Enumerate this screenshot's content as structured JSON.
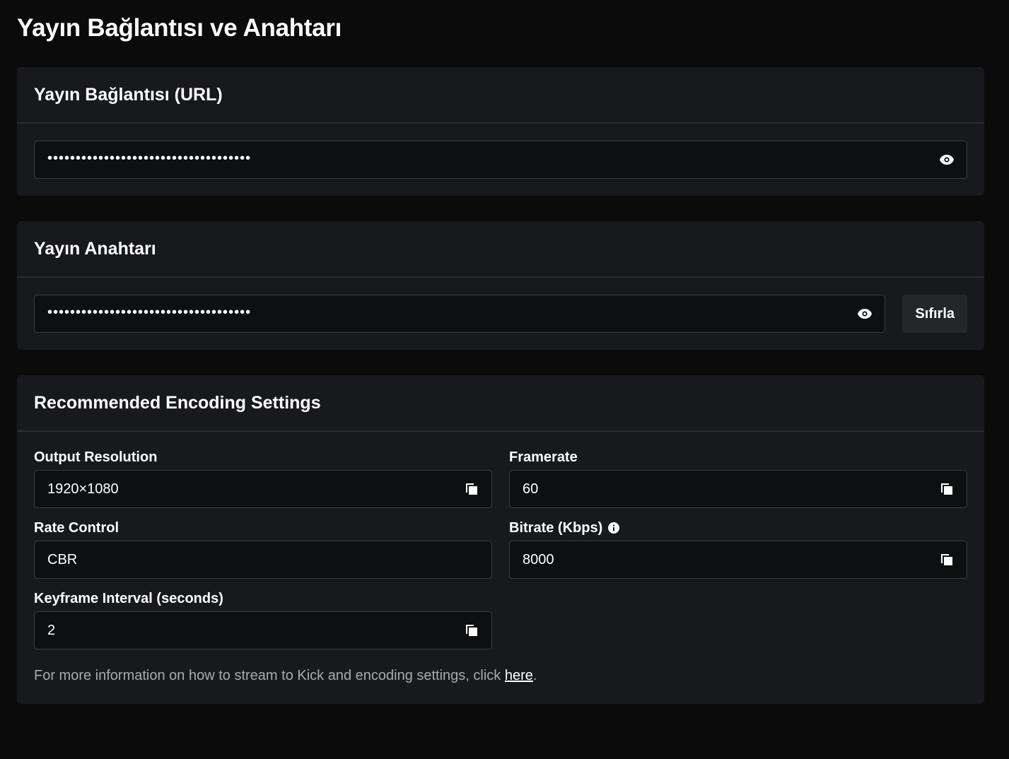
{
  "page": {
    "title": "Yayın Bağlantısı ve Anahtarı"
  },
  "stream_url": {
    "title": "Yayın Bağlantısı (URL)",
    "masked_value": "••••••••••••••••••••••••••••••••••••",
    "reveal_icon": "eye-icon"
  },
  "stream_key": {
    "title": "Yayın Anahtarı",
    "masked_value": "••••••••••••••••••••••••••••••••••••",
    "reveal_icon": "eye-icon",
    "reset_label": "Sıfırla"
  },
  "encoding": {
    "title": "Recommended Encoding Settings",
    "fields": {
      "output_resolution": {
        "label": "Output Resolution",
        "value": "1920×1080",
        "icon": "copy-icon"
      },
      "framerate": {
        "label": "Framerate",
        "value": "60",
        "icon": "copy-icon"
      },
      "rate_control": {
        "label": "Rate Control",
        "value": "CBR"
      },
      "bitrate": {
        "label": "Bitrate (Kbps)",
        "value": "8000",
        "icon": "copy-icon",
        "info_icon": "info-icon"
      },
      "keyframe_interval": {
        "label": "Keyframe Interval (seconds)",
        "value": "2",
        "icon": "copy-icon"
      }
    },
    "footer": {
      "text": "For more information on how to stream to Kick and encoding settings, click ",
      "link_text": "here",
      "suffix": "."
    }
  },
  "colors": {
    "background": "#0b0b0c",
    "card": "#18191c",
    "input_bg": "#0e0f10",
    "border": "#3a3c41",
    "muted_text": "#a8abb1"
  }
}
